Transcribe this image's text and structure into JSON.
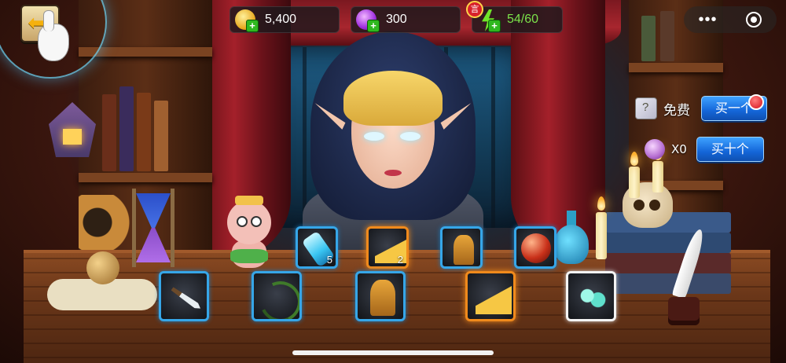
{
  "hud": {
    "gold": {
      "value": "5,400",
      "icon": "gold-coin-icon"
    },
    "gems": {
      "value": "300",
      "icon": "purple-gem-icon"
    },
    "energy": {
      "value": "54/60",
      "icon": "energy-bolt-icon",
      "badge": "言",
      "color": "#7be24a"
    }
  },
  "purchase": {
    "free": {
      "label": "免费",
      "button": "买一个",
      "icon": "draw-ticket-icon",
      "has_notification": true
    },
    "ten": {
      "label": "X0",
      "button": "买十个",
      "icon": "shell-token-icon"
    }
  },
  "items_top": [
    {
      "name": "potion-vial",
      "count": "5",
      "border": "blue"
    },
    {
      "name": "cheese-wedge",
      "count": "2",
      "border": "orange"
    },
    {
      "name": "golden-dragon-statue",
      "count": "",
      "border": "blue"
    },
    {
      "name": "red-orb",
      "count": "",
      "border": "blue"
    }
  ],
  "items_bottom": [
    {
      "name": "dagger",
      "border": "blue"
    },
    {
      "name": "thorn-vine",
      "border": "blue"
    },
    {
      "name": "golden-dragon-statue",
      "border": "blue"
    },
    {
      "name": "cheese-wedge",
      "border": "orange"
    },
    {
      "name": "teal-gems",
      "border": "white"
    }
  ],
  "colors": {
    "accent_blue": "#1466d9",
    "gold": "#f5b10d",
    "frame_blue": "#36a6e8",
    "frame_orange": "#f08a1c"
  }
}
